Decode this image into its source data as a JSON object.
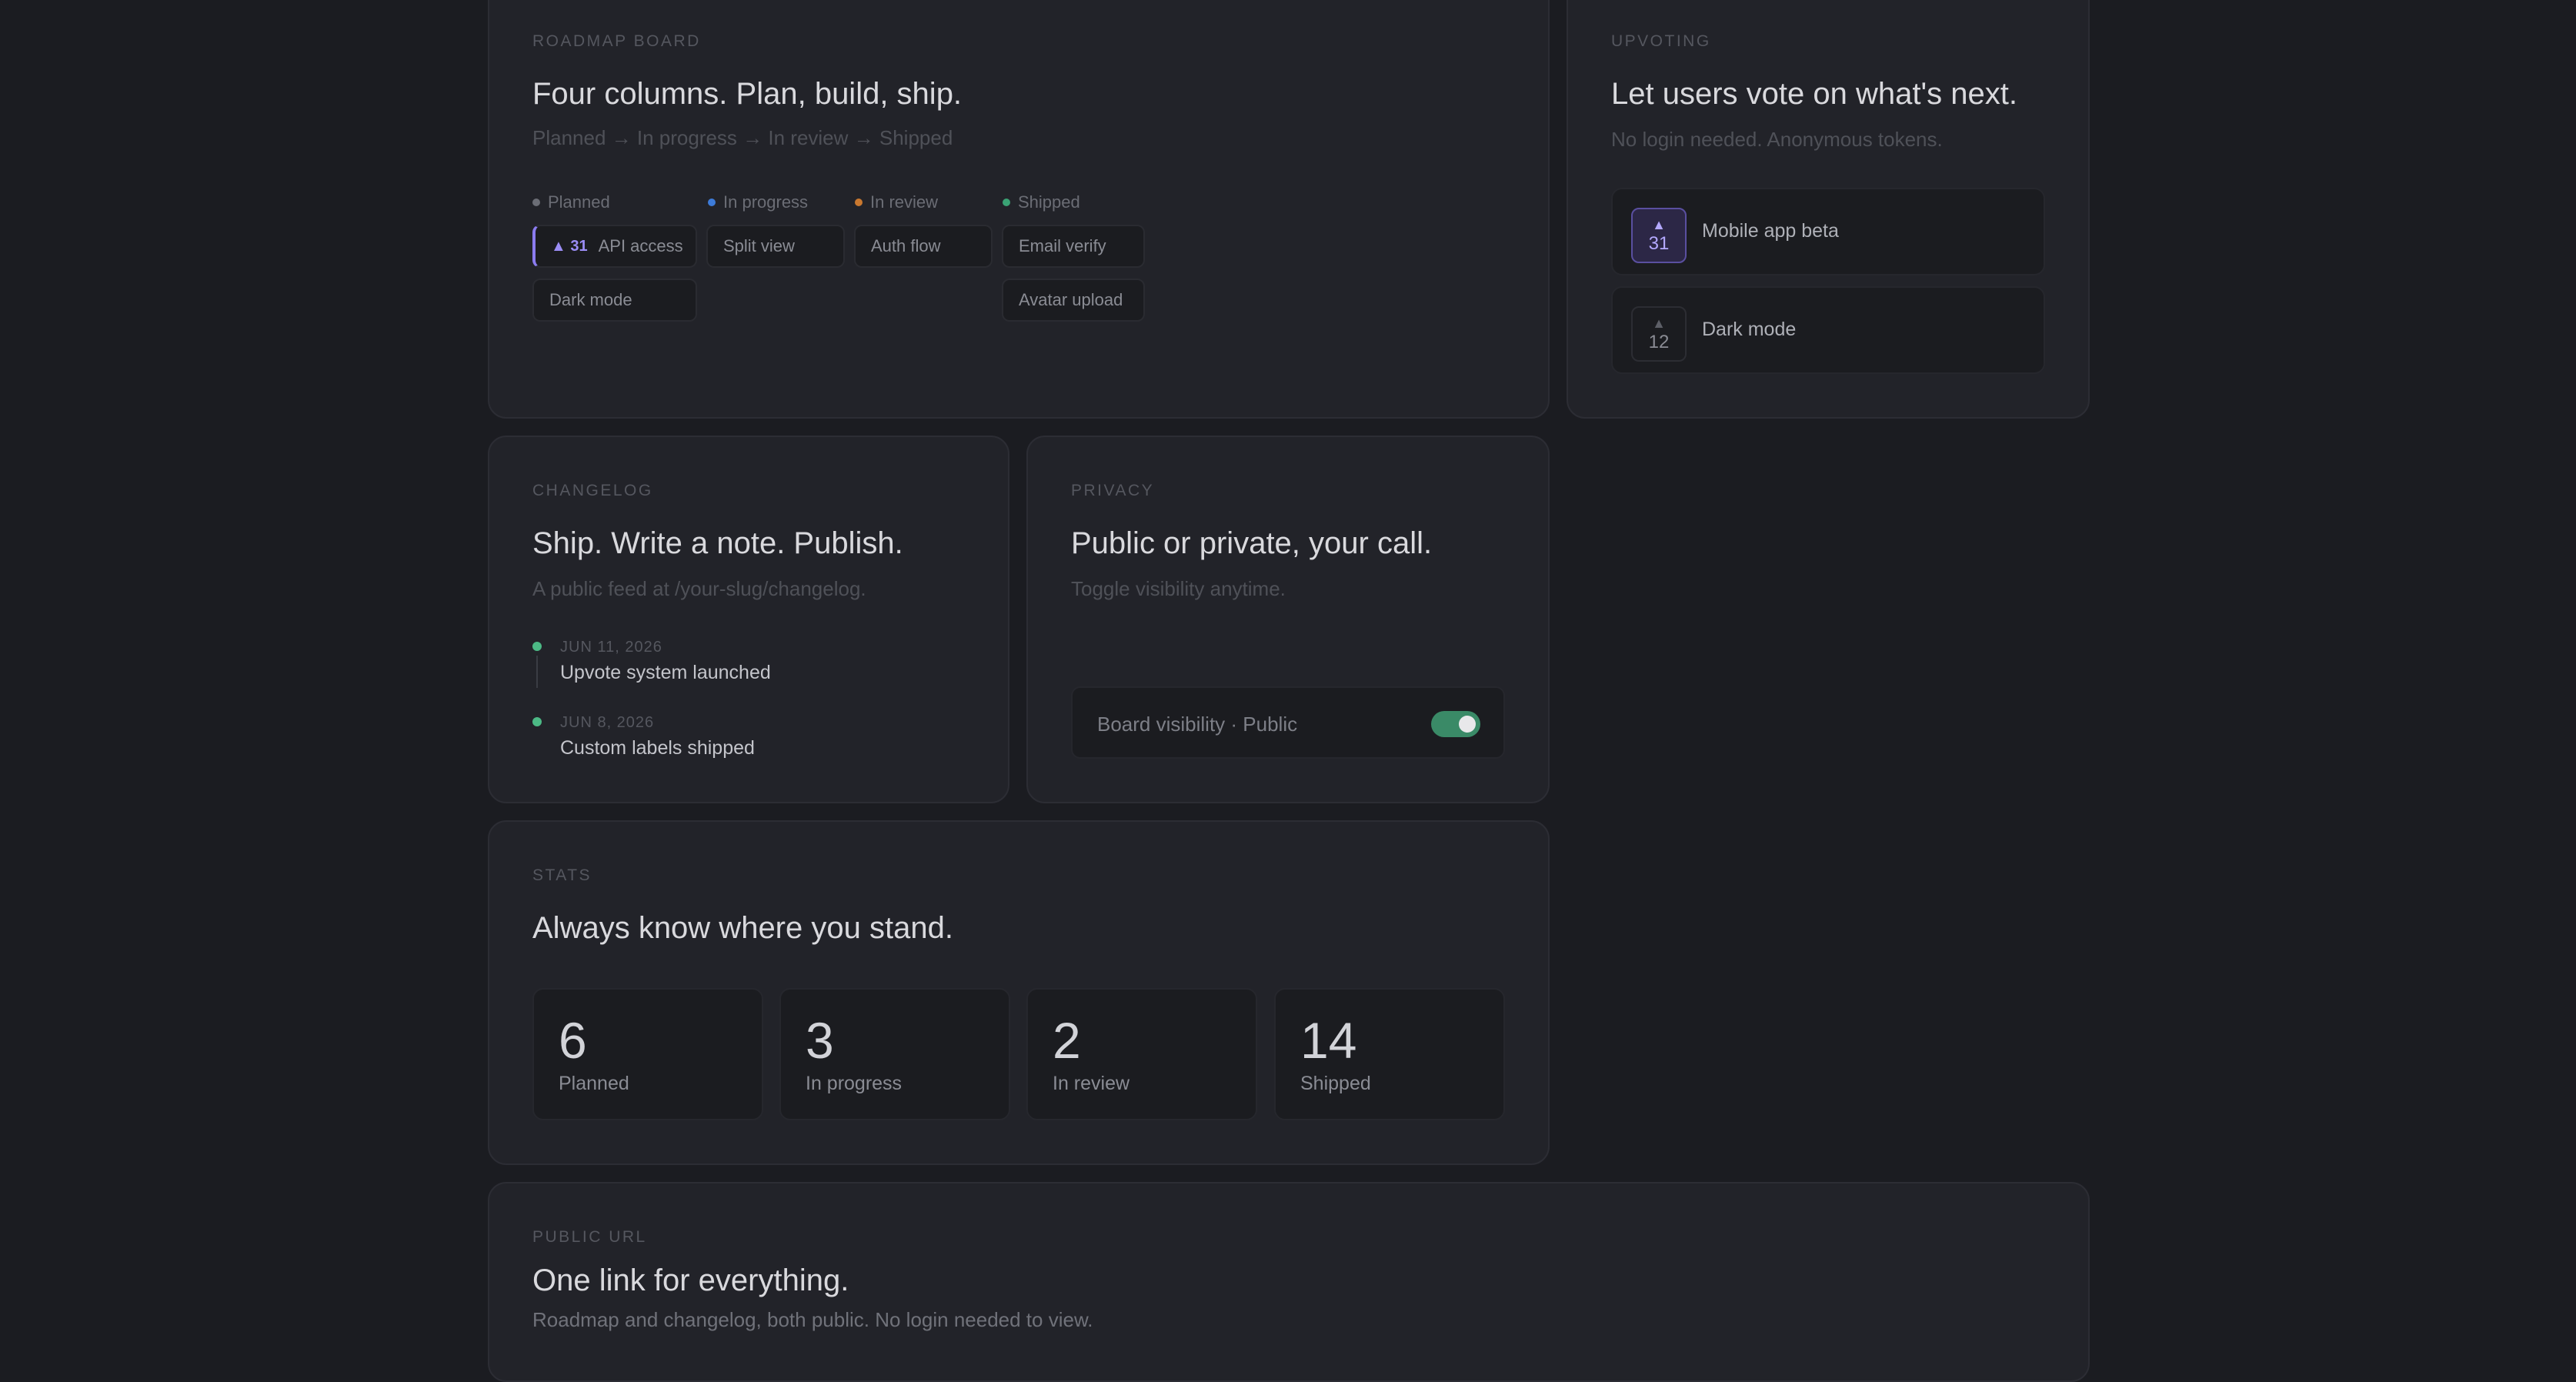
{
  "roadmap": {
    "eyebrow": "ROADMAP BOARD",
    "title": "Four columns. Plan, build, ship.",
    "subtitle": "Planned → In progress → In review → Shipped",
    "columns": [
      {
        "label": "Planned",
        "color": "#6b6d75",
        "items": [
          {
            "votes": "▲ 31",
            "label": "API access"
          },
          {
            "label": "Dark mode"
          }
        ]
      },
      {
        "label": "In progress",
        "color": "#3d7bd9",
        "items": [
          {
            "label": "Split view"
          }
        ]
      },
      {
        "label": "In review",
        "color": "#c9782f",
        "items": [
          {
            "label": "Auth flow"
          }
        ]
      },
      {
        "label": "Shipped",
        "color": "#3aa274",
        "items": [
          {
            "label": "Email verify"
          },
          {
            "label": "Avatar upload"
          }
        ]
      }
    ]
  },
  "upvoting": {
    "eyebrow": "UPVOTING",
    "title": "Let users vote on what's next.",
    "subtitle": "No login needed. Anonymous tokens.",
    "items": [
      {
        "arrow": "▲",
        "count": "31",
        "label": "Mobile app beta"
      },
      {
        "arrow": "▲",
        "count": "12",
        "label": "Dark mode"
      }
    ]
  },
  "changelog": {
    "eyebrow": "CHANGELOG",
    "title": "Ship. Write a note. Publish.",
    "subtitle": "A public feed at /your-slug/changelog.",
    "entries": [
      {
        "date": "JUN 11, 2026",
        "text": "Upvote system launched"
      },
      {
        "date": "JUN 8, 2026",
        "text": "Custom labels shipped"
      }
    ]
  },
  "privacy": {
    "eyebrow": "PRIVACY",
    "title": "Public or private, your call.",
    "subtitle": "Toggle visibility anytime.",
    "toggle_label": "Board visibility · Public",
    "toggle_on": true
  },
  "stats": {
    "eyebrow": "STATS",
    "title": "Always know where you stand.",
    "items": [
      {
        "value": "6",
        "label": "Planned"
      },
      {
        "value": "3",
        "label": "In progress"
      },
      {
        "value": "2",
        "label": "In review"
      },
      {
        "value": "14",
        "label": "Shipped"
      }
    ]
  },
  "public_url": {
    "eyebrow": "PUBLIC URL",
    "title": "One link for everything.",
    "subtitle": "Roadmap and changelog, both public. No login needed to view."
  }
}
